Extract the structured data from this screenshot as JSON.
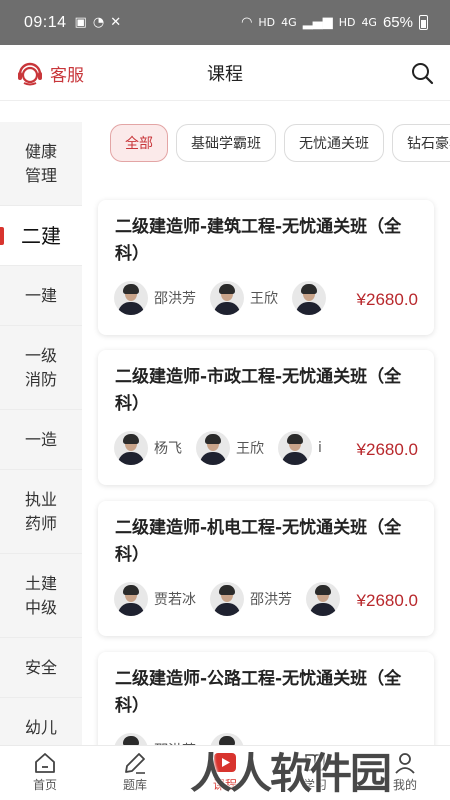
{
  "status_bar": {
    "time": "09:14",
    "hd1": "HD",
    "net": "4G",
    "hd2": "HD",
    "net2": "4G",
    "battery": "65%"
  },
  "header": {
    "customer_service": "客服",
    "title": "课程"
  },
  "sidebar": {
    "items": [
      {
        "label": "健康管理"
      },
      {
        "label": "二建"
      },
      {
        "label": "一建"
      },
      {
        "label": "一级消防"
      },
      {
        "label": "一造"
      },
      {
        "label": "执业药师"
      },
      {
        "label": "土建中级"
      },
      {
        "label": "安全"
      },
      {
        "label": "幼儿"
      }
    ]
  },
  "filters": [
    {
      "label": "全部"
    },
    {
      "label": "基础学霸班"
    },
    {
      "label": "无忧通关班"
    },
    {
      "label": "钻石豪华"
    }
  ],
  "courses": [
    {
      "title": "二级建造师-建筑工程-无忧通关班（全科）",
      "teachers": [
        {
          "name": "邵洪芳"
        },
        {
          "name": "王欣"
        },
        {
          "name": ""
        }
      ],
      "price": "¥2680.0"
    },
    {
      "title": "二级建造师-市政工程-无忧通关班（全科）",
      "teachers": [
        {
          "name": "杨飞"
        },
        {
          "name": "王欣"
        },
        {
          "name": "i"
        }
      ],
      "price": "¥2680.0"
    },
    {
      "title": "二级建造师-机电工程-无忧通关班（全科）",
      "teachers": [
        {
          "name": "贾若冰"
        },
        {
          "name": "邵洪芳"
        },
        {
          "name": ""
        }
      ],
      "price": "¥2680.0"
    },
    {
      "title": "二级建造师-公路工程-无忧通关班（全科）",
      "teachers": [
        {
          "name": "邵洪芳"
        },
        {
          "name": ""
        }
      ],
      "price": ""
    }
  ],
  "bottom_nav": [
    {
      "label": "首页",
      "icon": "home-icon"
    },
    {
      "label": "题库",
      "icon": "pencil-icon"
    },
    {
      "label": "课程",
      "icon": "play-icon"
    },
    {
      "label": "学习",
      "icon": "book-icon"
    },
    {
      "label": "我的",
      "icon": "user-icon"
    }
  ],
  "watermark": "人人软件园",
  "colors": {
    "accent": "#d8342e",
    "price": "#b8282c",
    "status_bar": "#6e6e6e"
  }
}
